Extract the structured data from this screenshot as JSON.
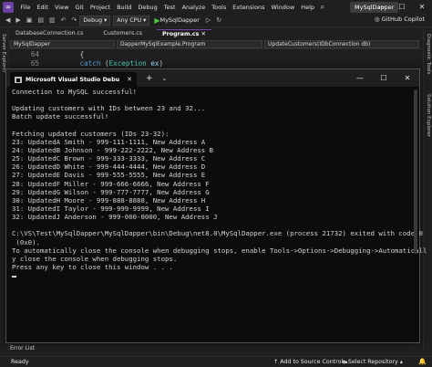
{
  "menubar": {
    "items": [
      "File",
      "Edit",
      "View",
      "Git",
      "Project",
      "Build",
      "Debug",
      "Test",
      "Analyze",
      "Tools",
      "Extensions",
      "Window",
      "Help"
    ],
    "solution_name": "MySqlDapper"
  },
  "toolbar": {
    "config": "Debug",
    "platform": "Any CPU",
    "run_target": "MySqlDapper",
    "copilot": "GitHub Copilot"
  },
  "left_strip": {
    "label": "Server Explorer"
  },
  "right_strip": {
    "label1": "Diagnostic Tools",
    "label2": "Solution Explorer"
  },
  "doc_tabs": [
    "DatabaseConnection.cs",
    "Customers.cs",
    "Program.cs"
  ],
  "nav": {
    "project": "MySqlDapper",
    "class": "DapperMySqlExample.Program",
    "member": "UpdateCustomers(IDbConnection db)"
  },
  "editor": {
    "lines": [
      {
        "num": "64",
        "text": "{"
      },
      {
        "num": "65",
        "catch_kw": "catch",
        "open": " (",
        "type": "Exception",
        "var": " ex",
        "close": ")"
      }
    ]
  },
  "console": {
    "title": "Microsoft Visual Studio Debu",
    "lines": [
      "Connection to MySQL successful!",
      "",
      "Updating customers with IDs between 23 and 32...",
      "Batch update successful!",
      "",
      "Fetching updated customers (IDs 23-32):",
      "23: UpdatedA Smith - 999-111-1111, New Address A",
      "24: UpdatedB Johnson - 999-222-2222, New Address B",
      "25: UpdatedC Brown - 999-333-3333, New Address C",
      "26: UpdatedD White - 999-444-4444, New Address D",
      "27: UpdatedE Davis - 999-555-5555, New Address E",
      "28: UpdatedF Miller - 999-666-6666, New Address F",
      "29: UpdatedG Wilson - 999-777-7777, New Address G",
      "30: UpdatedH Moore - 999-888-8888, New Address H",
      "31: UpdatedI Taylor - 999-999-9999, New Address I",
      "32: UpdatedJ Anderson - 999-000-0000, New Address J",
      "",
      "C:\\VS\\Test\\MySqlDapper\\MySqlDapper\\bin\\Debug\\net8.0\\MySqlDapper.exe (process 21732) exited with code 0",
      " (0x0).",
      "To automatically close the console when debugging stops, enable Tools->Options->Debugging->Automaticall",
      "y close the console when debugging stops.",
      "Press any key to close this window . . ."
    ]
  },
  "bottom": {
    "error_list": "Error List"
  },
  "status": {
    "ready": "Ready",
    "source_control": "Add to Source Control",
    "repository": "Select Repository"
  }
}
